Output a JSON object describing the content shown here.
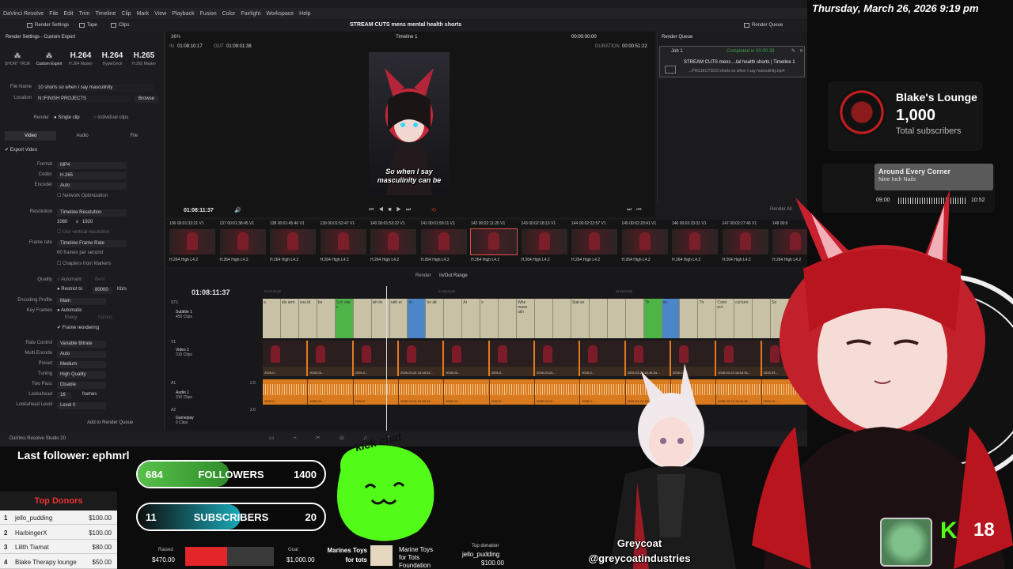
{
  "clock": "Thursday, March 26, 2026 9:19 pm",
  "resolve": {
    "menu": [
      "DaVinci Resolve",
      "File",
      "Edit",
      "Trim",
      "Timeline",
      "Clip",
      "Mark",
      "View",
      "Playback",
      "Fusion",
      "Color",
      "Fairlight",
      "Workspace",
      "Help"
    ],
    "toolbar": {
      "render_settings": "Render Settings",
      "tape": "Tape",
      "clips": "Clips",
      "project_title": "STREAM CUTS mens mental health shorts",
      "render_queue": "Render Queue"
    },
    "render_settings": {
      "header": "Render Settings - Custom Export",
      "presets": [
        {
          "big": "",
          "label": "SHORT TRUE"
        },
        {
          "big": "",
          "label": "Custom Export"
        },
        {
          "big": "H.264",
          "label": "H.264 Master"
        },
        {
          "big": "H.264",
          "label": "HyperDeck"
        },
        {
          "big": "H.265",
          "label": "H.265 Master"
        }
      ],
      "file_name_label": "File Name",
      "file_name": "10 shorts so when I say masculinity",
      "location_label": "Location",
      "location": "N:\\FINISH PROJECTS",
      "browse": "Browse",
      "render_label": "Render",
      "single_clip": "Single clip",
      "individual_clips": "Individual clips",
      "tabs": [
        "Video",
        "Audio",
        "File"
      ],
      "export_video": "Export Video",
      "format_label": "Format",
      "format": "MP4",
      "codec_label": "Codec",
      "codec": "H.265",
      "encoder_label": "Encoder",
      "encoder": "Auto",
      "network_opt": "Network Optimization",
      "resolution_label": "Resolution",
      "resolution": "Timeline Resolution",
      "res_w": "1080",
      "res_h": "1920",
      "use_vertical": "Use vertical resolution",
      "frame_rate_label": "Frame rate",
      "frame_rate": "Timeline Frame Rate",
      "fps": "60 frames per second",
      "chapters": "Chapters from Markers",
      "quality_label": "Quality",
      "automatic": "Automatic",
      "best": "Best",
      "restrict": "Restrict to",
      "bitrate": "80000",
      "kbs": "Kb/s",
      "encoding_profile_label": "Encoding Profile",
      "encoding_profile": "Main",
      "key_frames_label": "Key Frames",
      "every": "Every",
      "frames_word": "frames",
      "frame_reordering": "Frame reordering",
      "rate_control_label": "Rate Control",
      "rate_control": "Variable Bitrate",
      "multi_encode_label": "Multi Encode",
      "multi_encode": "Auto",
      "preset_label": "Preset",
      "preset": "Medium",
      "tuning_label": "Tuning",
      "tuning": "High Quality",
      "two_pass_label": "Two Pass",
      "two_pass": "Disable",
      "lookahead_label": "Lookahead",
      "lookahead": "16",
      "frames_label": "frames",
      "lookahead_level_label": "Lookahead Level",
      "lookahead_level": "Level 0",
      "add_to_queue": "Add to Render Queue"
    },
    "viewer": {
      "zoom": "36%",
      "timeline_name": "Timeline 1",
      "tc_top": "00:00:00:00",
      "in_label": "IN",
      "in_tc": "01:08:10:17",
      "out_label": "OUT",
      "out_tc": "01:09:01:38",
      "duration_label": "DURATION",
      "duration": "00:00:51:22",
      "caption_line1": "So when I say",
      "caption_line2": "masculinity can be",
      "current_tc": "01:08:11:37"
    },
    "queue": {
      "title": "Render Queue",
      "job": "Job 1",
      "status": "Completed in 00:00:38",
      "job_title": "STREAM CUTS mens ...tal health shorts | Timeline 1",
      "job_path": "...PROJECTS\\10 shorts so when I say masculinity.mp4",
      "render_all": "Render All"
    },
    "thumbs": [
      {
        "tc": "136 00:01:32:21 V1",
        "codec": "H.264 High L4.2"
      },
      {
        "tc": "137 00:01:38:45 V1",
        "codec": "H.264 High L4.2"
      },
      {
        "tc": "138 00:01:45:46 V1",
        "codec": "H.264 High L4.2"
      },
      {
        "tc": "139 00:01:52:47 V1",
        "codec": "H.264 High L4.2"
      },
      {
        "tc": "140 00:01:53:22 V1",
        "codec": "H.264 High L4.2"
      },
      {
        "tc": "141 00:01:59:11 V1",
        "codec": "H.264 High L4.2"
      },
      {
        "tc": "142 00:02:11:25 V1",
        "codec": "H.264 High L4.2"
      },
      {
        "tc": "143 00:02:18:13 V1",
        "codec": "H.264 High L4.2"
      },
      {
        "tc": "144 00:02:22:57 V1",
        "codec": "H.264 High L4.2"
      },
      {
        "tc": "145 00:02:20:41 V1",
        "codec": "H.264 High L4.2"
      },
      {
        "tc": "146 00:02:23:31 V1",
        "codec": "H.264 High L4.2"
      },
      {
        "tc": "147 00:02:27:46 V1",
        "codec": "H.264 High L4.2"
      },
      {
        "tc": "148 00:0",
        "codec": "H.264 High L4.2"
      }
    ],
    "timeline": {
      "tc": "01:08:11:37",
      "render_label": "Render",
      "render_range": "In/Out Range",
      "ruler_start": "01:07:52:00",
      "ruler_mid": "01:08:24:00",
      "ruler_end": "01:09:03:00",
      "st1": "ST1",
      "subtitle_name": "Subtitle 1",
      "subtitle_count": "450 Clips",
      "v1": "V1",
      "video_name": "Video 1",
      "video_count": "310 Clips",
      "a1": "A1",
      "audio_name": "Audio 1",
      "audio_count": "310 Clips",
      "a2": "A2",
      "gameplay_name": "Gameplay",
      "gameplay_count": "0 Clips",
      "audio_level": "2.0",
      "subtitles": [
        "a",
        "dis arm",
        "cou ld",
        "be",
        "Sch olar s",
        "",
        "wh ile",
        "rath er",
        "m",
        "he alt",
        "",
        "Ar",
        "s",
        "",
        "Whe mase ulin",
        "",
        "",
        "Stat es",
        "",
        "",
        "",
        "Th",
        "en",
        "",
        "Th",
        "Conn ect",
        "cul ture",
        "",
        "So",
        "be"
      ],
      "video_clips": [
        "2026-0...",
        "2026-03...",
        "2026-0...",
        "2026-03-24 18-48-34...",
        "2026-03...",
        "2026-0...",
        "2026-03-24...",
        "2026-0...",
        "2026-03-24 18-48-34...",
        "2026-0...",
        "2026-03-24 18-54-51...",
        "2026-03..."
      ],
      "audio_clips": [
        "2026-0...",
        "2026-03...",
        "2026-0...",
        "2026-03-24 18-48-34...",
        "2026-03...",
        "2026-0...",
        "2026-03-24...",
        "2026-0...",
        "2026-03-24 18-48-34...",
        "2026-0...",
        "2026-03-24 18-54-51...",
        "2026-03..."
      ]
    },
    "footer": "DaVinci Resolve Studio 20"
  },
  "youtube": {
    "name": "Blake's Lounge",
    "count": "1,000",
    "label": "Total subscribers"
  },
  "music": {
    "song": "Around Every Corner",
    "artist": "Nine Inch Nails",
    "elapsed": "09:00",
    "total": "10:52",
    "progress": 0.83
  },
  "last_follower": "Last follower: ephmrl",
  "donors": {
    "title": "Top Donors",
    "list": [
      {
        "rank": "1",
        "name": "jello_pudding",
        "amount": "$100.00"
      },
      {
        "rank": "2",
        "name": "HarbingerX",
        "amount": "$100.00"
      },
      {
        "rank": "3",
        "name": "Lilith Tiamat",
        "amount": "$80.00"
      },
      {
        "rank": "4",
        "name": "Blake Therapy lounge",
        "amount": "$50.00"
      }
    ]
  },
  "followers_goal": {
    "current": "684",
    "label": "FOLLOWERS",
    "target": "1400",
    "fraction": 0.49,
    "color": "#58c24a"
  },
  "subs_goal": {
    "current": "11",
    "label": "SUBSCRIBERS",
    "target": "20",
    "fraction": 0.55,
    "color": "#1aa8b8"
  },
  "kick_chat": "kick chat",
  "charity": {
    "raised_label": "Raised",
    "raised": "$470.00",
    "goal_label": "Goal",
    "goal": "$1,000.00",
    "org_line1": "Marines Toys",
    "org_line2": "for tots",
    "logo_line1": "Marine Toys",
    "logo_line2": "for Tots",
    "logo_line3": "Foundation",
    "top_label": "Top donation",
    "top_name": "jello_pudding",
    "top_amount": "$100.00",
    "progress": 0.47
  },
  "greycoat": {
    "name": "Greycoat",
    "handle": "@greycoatindustries"
  },
  "kick_count": "18",
  "colors": {
    "kick_green": "#53fc18",
    "donor_red": "#e33333",
    "orange_clip": "#e27b20"
  }
}
